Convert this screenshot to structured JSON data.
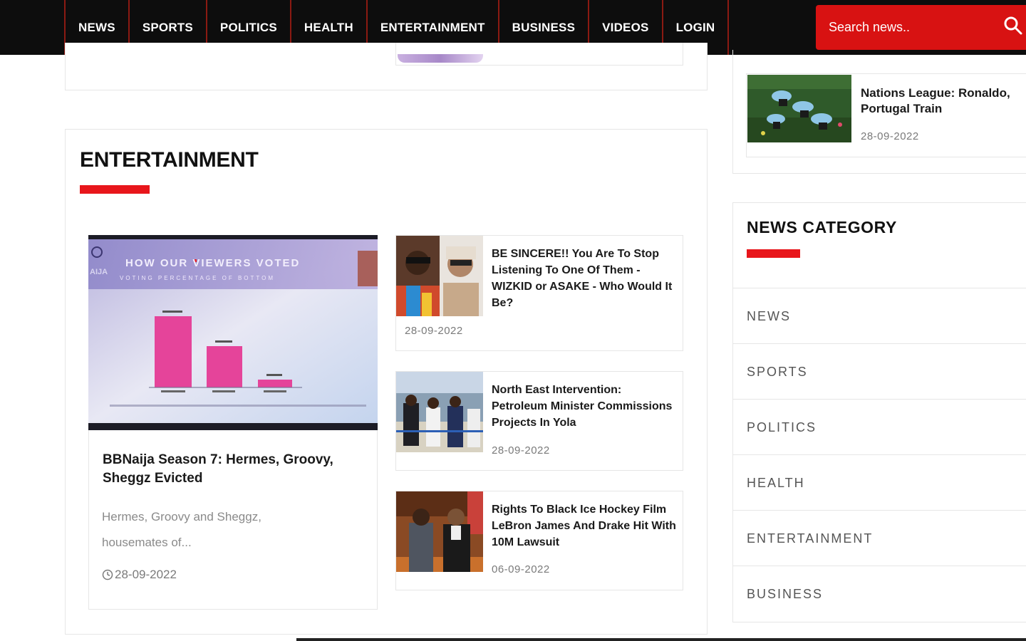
{
  "nav": {
    "items": [
      "NEWS",
      "SPORTS",
      "POLITICS",
      "HEALTH",
      "ENTERTAINMENT",
      "BUSINESS",
      "VIDEOS",
      "LOGIN"
    ]
  },
  "search": {
    "placeholder": "Search news.."
  },
  "entertainment": {
    "title": "ENTERTAINMENT",
    "featured": {
      "image_text": {
        "heading": "HOW OUR VIEWERS VOTED",
        "subheading": "VOTING PERCENTAGE OF BOTTOM",
        "logo": "AIJA"
      },
      "title": "BBNaija Season 7: Hermes, Groovy, Sheggz Evicted",
      "excerpt": "Hermes, Groovy and Sheggz, housemates of...",
      "date": "28-09-2022"
    },
    "cards": [
      {
        "title": "BE SINCERE!! You Are To Stop Listening To One Of Them - WIZKID or ASAKE - Who Would It Be?",
        "date": "28-09-2022"
      },
      {
        "title": "North East Intervention: Petroleum Minister Commissions Projects In Yola",
        "date": "28-09-2022"
      },
      {
        "title": "Rights To Black Ice Hockey Film LeBron James And Drake Hit With 10M Lawsuit",
        "date": "06-09-2022"
      }
    ]
  },
  "sidebar": {
    "top_card": {
      "title": "Nations League: Ronaldo, Portugal Train",
      "date": "28-09-2022"
    },
    "category_title": "NEWS CATEGORY",
    "categories": [
      "NEWS",
      "SPORTS",
      "POLITICS",
      "HEALTH",
      "ENTERTAINMENT",
      "BUSINESS"
    ]
  },
  "colors": {
    "accent": "#e8161b",
    "nav_bg": "#0d0d0d",
    "search_bg": "#d81212"
  }
}
